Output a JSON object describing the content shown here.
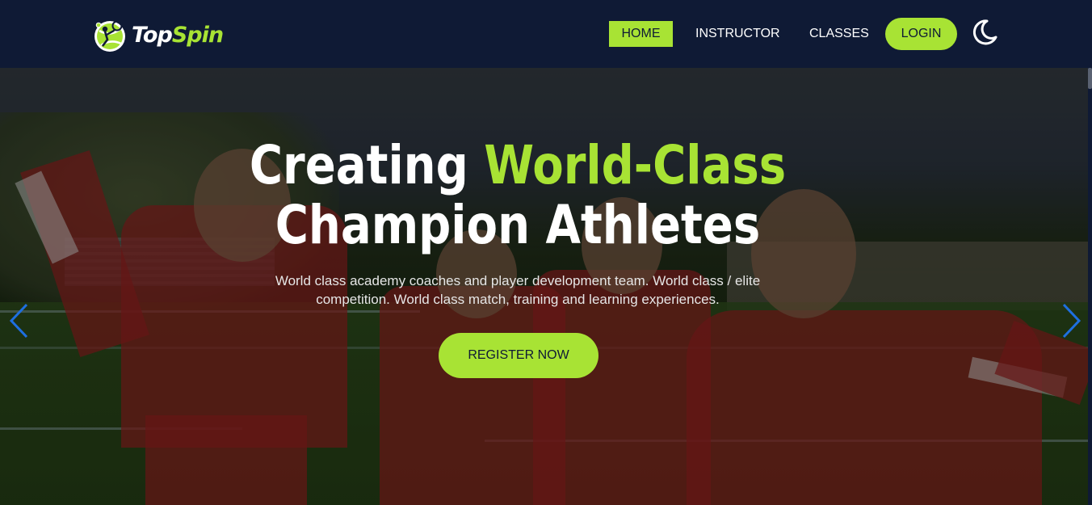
{
  "brand": {
    "name_part1": "Top",
    "name_part2": "Spin",
    "logo_icon": "tennis-player-ball-icon"
  },
  "nav": {
    "items": [
      {
        "label": "HOME",
        "active": true
      },
      {
        "label": "INSTRUCTOR",
        "active": false
      },
      {
        "label": "CLASSES",
        "active": false
      }
    ],
    "login_label": "LOGIN",
    "theme_icon": "moon-icon"
  },
  "hero": {
    "headline_part1": "Creating ",
    "headline_accent": "World-Class",
    "headline_line2": "Champion Athletes",
    "subtext": "World class academy coaches and player development team. World class / elite competition. World class match, training and learning experiences.",
    "cta_label": "REGISTER NOW",
    "prev_icon": "chevron-left-icon",
    "next_icon": "chevron-right-icon"
  },
  "colors": {
    "navbar_bg": "#0f1a35",
    "accent": "#a8e334",
    "slider_arrow": "#1e6fe0"
  }
}
